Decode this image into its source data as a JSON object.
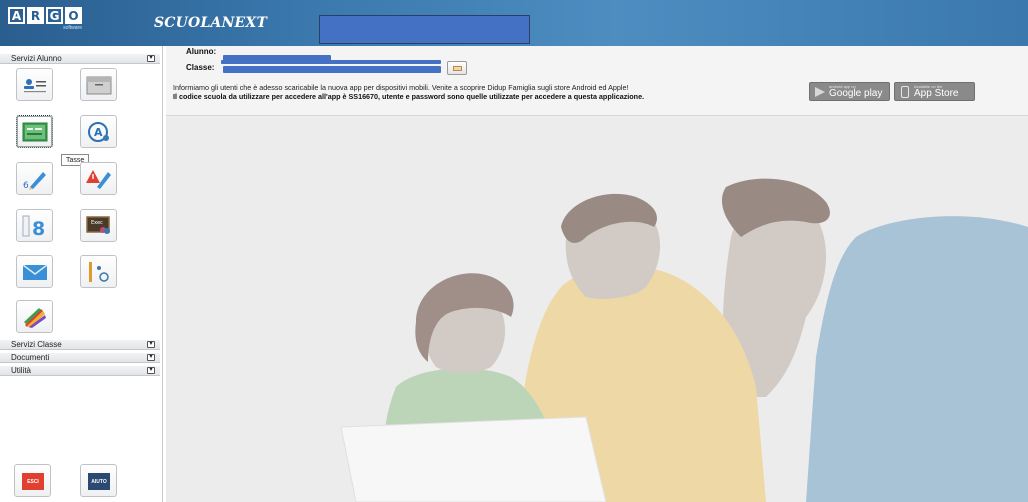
{
  "header": {
    "logo_letters": [
      "A",
      "R",
      "G",
      "O"
    ],
    "logo_sub": "software",
    "app_name": "SCUOLANEXT",
    "colors": {
      "bar": "#3a78ad",
      "redaction": "#4471c4"
    }
  },
  "sidebar": {
    "sections": {
      "servizi_alunno": "Servizi Alunno",
      "servizi_classe": "Servizi Classe",
      "documenti": "Documenti",
      "utilita": "Utilità"
    },
    "toggle_glyph": "▾",
    "tiles": [
      {
        "icon": "student-profile-icon"
      },
      {
        "icon": "folder-cabinet-icon"
      },
      {
        "icon": "tasse-icon"
      },
      {
        "icon": "student-account-icon"
      },
      {
        "icon": "grade-pencil-icon"
      },
      {
        "icon": "note-alert-icon"
      },
      {
        "icon": "registro-icon"
      },
      {
        "icon": "lesson-board-icon"
      },
      {
        "icon": "mail-envelope-icon"
      },
      {
        "icon": "document-globe-icon"
      },
      {
        "icon": "color-pencils-icon"
      }
    ],
    "tooltip": "Tasse",
    "bottom_buttons": {
      "exit": "ESCI",
      "help": "AIUTO"
    }
  },
  "student_panel": {
    "alunno_label": "Alunno:",
    "classe_label": "Classe:",
    "info_line_1": "Informiamo gli utenti che è adesso scaricabile la nuova app per dispositivi mobili. Venite a scoprire Didup Famiglia sugli store Android ed Apple!",
    "info_line_2": "Il codice scuola da utilizzare per accedere all'app è SS16670, utente e password sono quelle utilizzate per accedere a questa applicazione.",
    "google_badge": {
      "small": "android app on",
      "big": "Google play"
    },
    "apple_badge": {
      "small": "Available on the",
      "big": "App Store"
    }
  }
}
